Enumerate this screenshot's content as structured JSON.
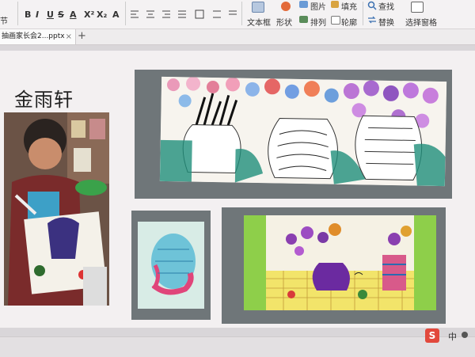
{
  "ribbon": {
    "left_section_label": "节",
    "format_buttons": [
      "B",
      "I",
      "U",
      "S",
      "A",
      "X²",
      "X₂",
      "A"
    ],
    "text_box_label": "文本框",
    "shape_label": "形状",
    "picture_label": "图片",
    "fill_label": "填充",
    "find_label": "查找",
    "arrange_label": "排列",
    "outline_label": "轮廓",
    "replace_label": "替换",
    "select_pane_label": "选择窗格"
  },
  "tabs": [
    {
      "label": "抽画家长会2...pptx",
      "close": "×"
    }
  ],
  "new_tab": "+",
  "slide": {
    "title": "金雨轩"
  },
  "status": {
    "ime_logo": "S",
    "ime_lang": "中"
  },
  "colors": {
    "ime_red": "#e2483c",
    "frame_gray": "#6f7679"
  }
}
